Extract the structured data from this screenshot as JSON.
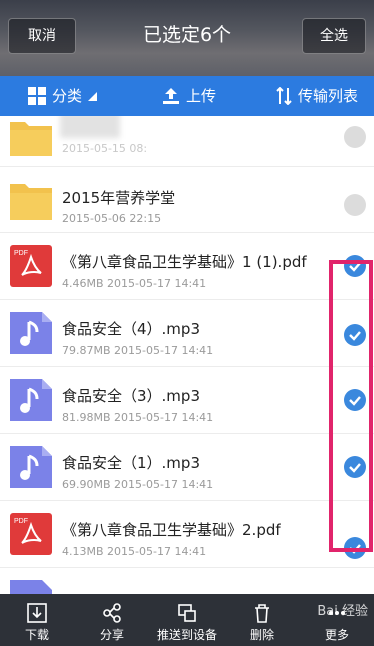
{
  "header": {
    "cancel_label": "取消",
    "title": "已选定6个",
    "select_all_label": "全选"
  },
  "toolbar": {
    "category_label": "分类",
    "upload_label": "上传",
    "transfer_label": "传输列表"
  },
  "files": [
    {
      "name": "",
      "meta": "2015-05-15 08:",
      "type": "folder",
      "checked": false
    },
    {
      "name": "2015年营养学堂",
      "meta": "2015-05-06  22:15",
      "type": "folder",
      "checked": false
    },
    {
      "name": "《第八章食品卫生学基础》1 (1).pdf",
      "meta": "4.46MB  2015-05-17  14:41",
      "type": "pdf",
      "checked": true
    },
    {
      "name": "食品安全（4）.mp3",
      "meta": "79.87MB  2015-05-17  14:41",
      "type": "audio",
      "checked": true
    },
    {
      "name": "食品安全（3）.mp3",
      "meta": "81.98MB  2015-05-17  14:41",
      "type": "audio",
      "checked": true
    },
    {
      "name": "食品安全（1）.mp3",
      "meta": "69.90MB  2015-05-17  14:41",
      "type": "audio",
      "checked": true
    },
    {
      "name": "《第八章食品卫生学基础》2.pdf",
      "meta": "4.13MB  2015-05-17  14:41",
      "type": "pdf",
      "checked": true
    }
  ],
  "pdf_badge": "PDF",
  "bottom_bar": {
    "download_label": "下载",
    "share_label": "分享",
    "push_label": "推送到设备",
    "delete_label": "删除",
    "more_label": "更多"
  },
  "watermark": "Bai 经验",
  "colors": {
    "header_bg": "#5a5c63",
    "toolbar_bg": "#2c7be0",
    "check_on": "#3a88dd",
    "highlight": "#e1246b",
    "folder": "#f2c24d",
    "pdf": "#e03a3a",
    "audio": "#7b82e8",
    "bottom_bg": "#2d3138"
  }
}
